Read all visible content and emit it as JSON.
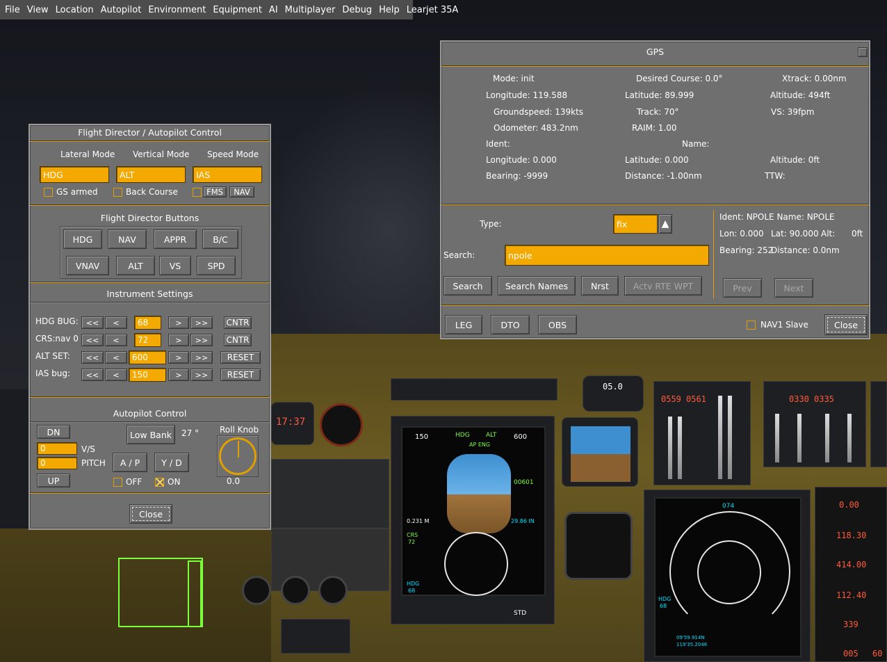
{
  "menubar": {
    "items": [
      "File",
      "View",
      "Location",
      "Autopilot",
      "Environment",
      "Equipment",
      "AI",
      "Multiplayer",
      "Debug",
      "Help",
      "Learjet 35A"
    ]
  },
  "autopilot_dialog": {
    "title": "Flight Director / Autopilot Control",
    "mode_headers": {
      "lateral": "Lateral Mode",
      "vertical": "Vertical Mode",
      "speed": "Speed Mode"
    },
    "mode_values": {
      "lateral": "HDG",
      "vertical": "ALT",
      "speed": "IAS"
    },
    "checks": {
      "gs_armed": "GS armed",
      "back_course": "Back Course",
      "fms": "FMS",
      "nav": "NAV"
    },
    "fd_title": "Flight Director Buttons",
    "fd_buttons": [
      "HDG",
      "NAV",
      "APPR",
      "B/C",
      "VNAV",
      "ALT",
      "VS",
      "SPD"
    ],
    "instr_title": "Instrument Settings",
    "instr_rows": [
      {
        "label": "HDG BUG:",
        "value": "68",
        "action": "CNTR"
      },
      {
        "label": "CRS:nav 0",
        "value": "72",
        "action": "CNTR"
      },
      {
        "label": "ALT SET:",
        "value": "600",
        "action": "RESET"
      },
      {
        "label": "IAS bug:",
        "value": "150",
        "action": "RESET"
      }
    ],
    "step": {
      "ll": "<<",
      "l": "<",
      "r": ">",
      "rr": ">>"
    },
    "ap_title": "Autopilot Control",
    "dn": "DN",
    "up": "UP",
    "vs_value": "0",
    "vs_label": "V/S",
    "pitch_value": "0",
    "pitch_label": "PITCH",
    "low_bank": "Low Bank",
    "bank_angle": "27 °",
    "ap_button": "A / P",
    "yd_button": "Y / D",
    "off": "OFF",
    "on": "ON",
    "on_checked": true,
    "roll_knob_label": "Roll Knob",
    "roll_knob_value": "0.0",
    "close": "Close"
  },
  "gps_dialog": {
    "title": "GPS",
    "status": {
      "mode": "Mode: init",
      "desired_course": "Desired Course:  0.0°",
      "xtrack": "Xtrack:  0.00nm",
      "longitude": "Longitude: 119.588",
      "latitude": "Latitude: 89.999",
      "altitude": "Altitude:    494ft",
      "groundspeed": "Groundspeed:  139kts",
      "track": "Track:  70°",
      "vs": "VS:    39fpm",
      "odometer": "Odometer: 483.2nm",
      "raim": "RAIM: 1.00"
    },
    "wp": {
      "ident": "Ident:",
      "name": "Name:",
      "longitude": "Longitude:  0.000",
      "latitude": "Latitude:  0.000",
      "altitude": "Altitude:        0ft",
      "bearing": "Bearing: -9999",
      "distance": "Distance: -1.00nm",
      "ttw": "TTW:"
    },
    "type_label": "Type:",
    "type_value": "fix",
    "search_label": "Search:",
    "search_value": "npole",
    "result": {
      "ident_name": "Ident: NPOLE  Name: NPOLE",
      "lon": "Lon:  0.000",
      "lat": "Lat: 90.000",
      "alt": "Alt:",
      "alt_value": "0ft",
      "bearing": "Bearing: 252",
      "distance": "Distance:   0.0nm"
    },
    "buttons": {
      "search": "Search",
      "search_names": "Search Names",
      "nrst": "Nrst",
      "actv": "Actv RTE WPT",
      "prev": "Prev",
      "next": "Next",
      "leg": "LEG",
      "dto": "DTO",
      "obs": "OBS",
      "close": "Close"
    },
    "nav1_slave": "NAV1 Slave"
  },
  "cockpit": {
    "clock": "17:37",
    "baro_top": "05.0",
    "n1_left": "0559",
    "n1_right": "0561",
    "n2_left": "0330",
    "n2_right": "0335",
    "pfd_speed": "150",
    "pfd_alt": "600",
    "pfd_alt_readout": "00601",
    "pfd_mode_hdg": "HDG",
    "pfd_mode_alt": "ALT",
    "pfd_ap": "AP ENG",
    "pfd_baro": "29.86 IN",
    "pfd_mach": "0.231 M",
    "hdg_text": "HDG",
    "hdg_value": "68",
    "crs_text": "CRS",
    "crs_value": "72",
    "mfd_hdg": "074",
    "mfd_time": "09'59.914N",
    "mfd_pos": "119'35.2046",
    "std": "STD",
    "red_vals": [
      "0.00",
      "118.30",
      "414.00",
      "112.40",
      "339",
      "005",
      "60"
    ]
  }
}
